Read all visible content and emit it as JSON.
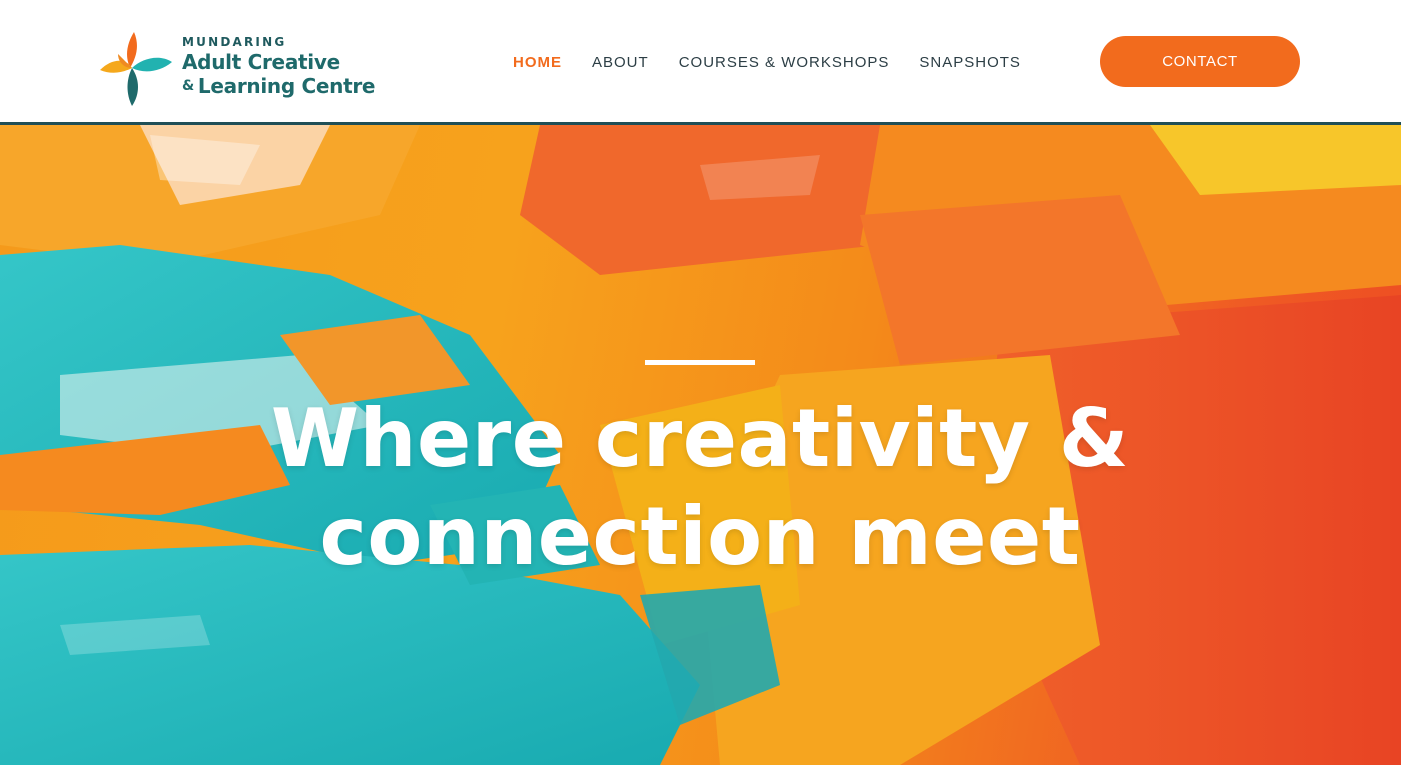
{
  "brand": {
    "line1": "MUNDARING",
    "line2": "Adult Creative",
    "line3_amp": "&",
    "line3": "Learning Centre",
    "logo_icon": "petal-swirl-logo-icon",
    "colors": {
      "teal": "#1f6a6b",
      "orange": "#f26b1d",
      "yellow": "#f5a81c"
    }
  },
  "nav": {
    "items": [
      {
        "label": "HOME",
        "active": true
      },
      {
        "label": "ABOUT",
        "active": false
      },
      {
        "label": "COURSES & WORKSHOPS",
        "active": false
      },
      {
        "label": "SNAPSHOTS",
        "active": false
      }
    ],
    "active_color": "#f26b1d",
    "text_color": "#2c3e45"
  },
  "contact": {
    "label": "CONTACT",
    "color": "#f26b1d"
  },
  "hero": {
    "headline_line1": "Where creativity &",
    "headline_line2": "connection meet",
    "background": "textured oil-paint strokes in orange, yellow, red and turquoise"
  }
}
